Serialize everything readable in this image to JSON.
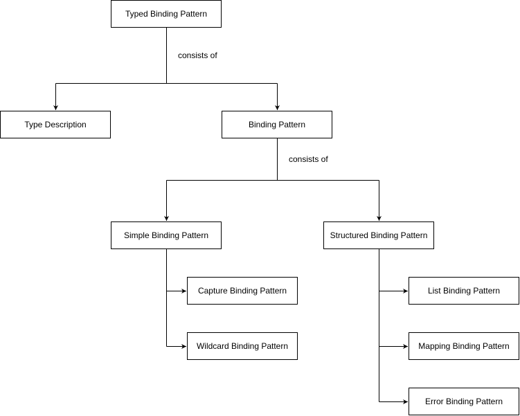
{
  "nodes": {
    "typed": "Typed Binding Pattern",
    "type_description": "Type Description",
    "binding": "Binding Pattern",
    "simple": "Simple Binding Pattern",
    "structured": "Structured Binding Pattern",
    "capture": "Capture Binding Pattern",
    "wildcard": "Wildcard Binding Pattern",
    "list": "List Binding Pattern",
    "mapping": "Mapping Binding Pattern",
    "error": "Error Binding Pattern"
  },
  "edge_labels": {
    "typed_consists": "consists of",
    "binding_consists": "consists of"
  }
}
